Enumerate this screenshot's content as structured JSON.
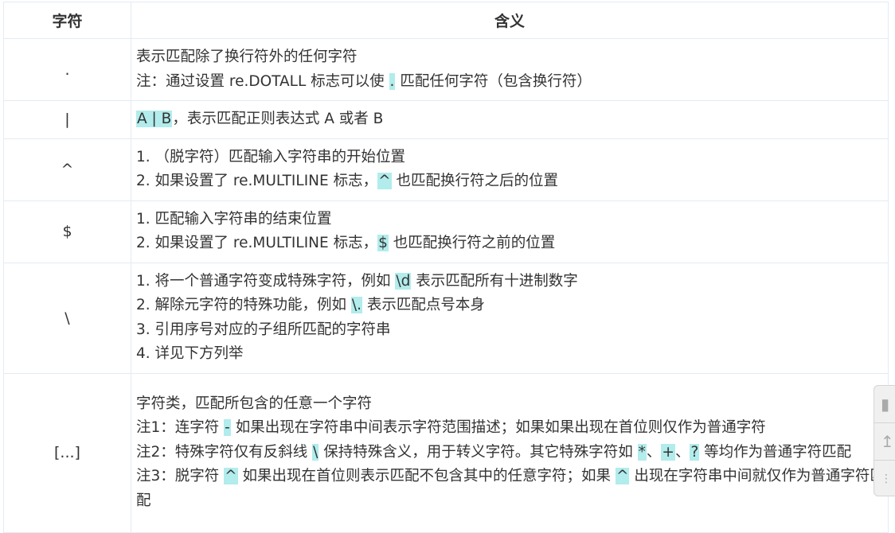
{
  "header": {
    "symbol": "字符",
    "meaning": "含义"
  },
  "rows": [
    {
      "symbol": ".",
      "lines": [
        [
          {
            "t": "表示匹配除了换行符外的任何字符"
          }
        ],
        [
          {
            "t": "注：通过设置 re.DOTALL 标志可以使 "
          },
          {
            "t": ".",
            "code": true
          },
          {
            "t": " 匹配任何字符（包含换行符）"
          }
        ]
      ]
    },
    {
      "symbol": "|",
      "lines": [
        [
          {
            "t": "A | B",
            "code": true
          },
          {
            "t": "，表示匹配正则表达式 A 或者 B"
          }
        ]
      ]
    },
    {
      "symbol": "^",
      "lines": [
        [
          {
            "t": "1. （脱字符）匹配输入字符串的开始位置"
          }
        ],
        [
          {
            "t": "2. 如果设置了 re.MULTILINE 标志，"
          },
          {
            "t": "^",
            "code": true
          },
          {
            "t": " 也匹配换行符之后的位置"
          }
        ]
      ]
    },
    {
      "symbol": "$",
      "lines": [
        [
          {
            "t": "1. 匹配输入字符串的结束位置"
          }
        ],
        [
          {
            "t": "2. 如果设置了 re.MULTILINE 标志，"
          },
          {
            "t": "$",
            "code": true
          },
          {
            "t": " 也匹配换行符之前的位置"
          }
        ]
      ]
    },
    {
      "symbol": "\\",
      "lines": [
        [
          {
            "t": "1. 将一个普通字符变成特殊字符，例如 "
          },
          {
            "t": "\\d",
            "code": true
          },
          {
            "t": " 表示匹配所有十进制数字"
          }
        ],
        [
          {
            "t": "2. 解除元字符的特殊功能，例如 "
          },
          {
            "t": "\\.",
            "code": true
          },
          {
            "t": " 表示匹配点号本身"
          }
        ],
        [
          {
            "t": "3. 引用序号对应的子组所匹配的字符串"
          }
        ],
        [
          {
            "t": "4. 详见下方列举"
          }
        ]
      ]
    },
    {
      "symbol": "[...]",
      "lines": [
        [
          {
            "t": "字符类，匹配所包含的任意一个字符"
          }
        ],
        [
          {
            "t": "注1：连字符 "
          },
          {
            "t": "-",
            "code": true
          },
          {
            "t": " 如果出现在字符串中间表示字符范围描述；如果如果出现在首位则仅作为普通字符"
          }
        ],
        [
          {
            "t": "注2：特殊字符仅有反斜线 "
          },
          {
            "t": "\\",
            "code": true
          },
          {
            "t": " 保持特殊含义，用于转义字符。其它特殊字符如 "
          },
          {
            "t": "*",
            "code": true
          },
          {
            "t": "、"
          },
          {
            "t": "+",
            "code": true
          },
          {
            "t": "、"
          },
          {
            "t": "?",
            "code": true
          },
          {
            "t": " 等均作为普通字符匹配"
          }
        ],
        [
          {
            "t": "注3：脱字符 "
          },
          {
            "t": "^",
            "code": true
          },
          {
            "t": " 如果出现在首位则表示匹配不包含其中的任意字符；如果 "
          },
          {
            "t": "^",
            "code": true
          },
          {
            "t": " 出现在字符串中间就仅作为普通字符匹配"
          }
        ]
      ]
    }
  ],
  "toolbar": {
    "icons": [
      "comment-icon",
      "back-to-top-icon",
      "grid-menu-icon"
    ]
  },
  "colors": {
    "code_bg": "#b2ecec",
    "border": "#e3ecf3"
  }
}
